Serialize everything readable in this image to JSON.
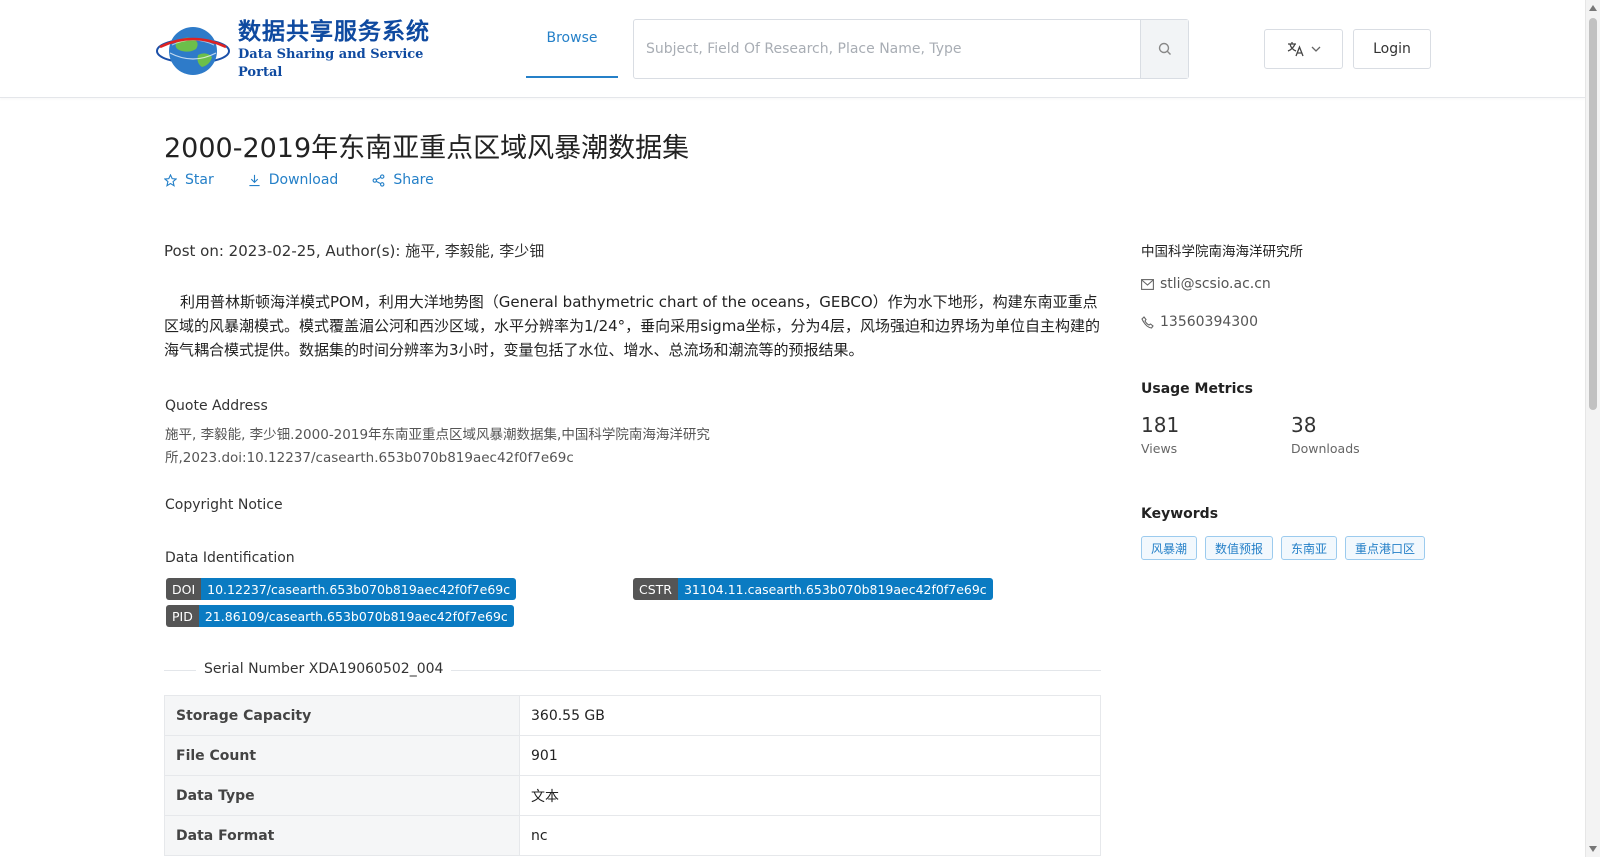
{
  "header": {
    "logo_cn": "数据共享服务系统",
    "logo_en": "Data Sharing and Service Portal",
    "nav_browse": "Browse",
    "search_placeholder": "Subject, Field Of Research, Place Name, Type",
    "login_label": "Login"
  },
  "dataset": {
    "title": "2000-2019年东南亚重点区域风暴潮数据集",
    "actions": {
      "star": "Star",
      "download": "Download",
      "share": "Share"
    },
    "post_on": "Post on: 2023-02-25, Author(s): 施平, 李毅能, 李少钿",
    "abstract": "利用普林斯顿海洋模式POM，利用大洋地势图（General bathymetric chart of the oceans，GEBCO）作为水下地形，构建东南亚重点区域的风暴潮模式。模式覆盖湄公河和西沙区域，水平分辨率为1/24°，垂向采用sigma坐标，分为4层，风场强迫和边界场为单位自主构建的海气耦合模式提供。数据集的时间分辨率为3小时，变量包括了水位、增水、总流场和潮流等的预报结果。",
    "quote_label": "Quote Address",
    "quote_text": "施平, 李毅能, 李少钿.2000-2019年东南亚重点区域风暴潮数据集,中国科学院南海海洋研究所,2023.doi:10.12237/casearth.653b070b819aec42f0f7e69c",
    "copyright_label": "Copyright Notice",
    "data_id_label": "Data Identification",
    "identifiers": {
      "doi_key": "DOI",
      "doi_val": "10.12237/casearth.653b070b819aec42f0f7e69c",
      "cstr_key": "CSTR",
      "cstr_val": "31104.11.casearth.653b070b819aec42f0f7e69c",
      "pid_key": "PID",
      "pid_val": "21.86109/casearth.653b070b819aec42f0f7e69c"
    },
    "serial_number": "Serial Number XDA19060502_004",
    "table": [
      {
        "k": "Storage Capacity",
        "v": "360.55 GB"
      },
      {
        "k": "File Count",
        "v": "901"
      },
      {
        "k": "Data Type",
        "v": "文本"
      },
      {
        "k": "Data Format",
        "v": "nc"
      }
    ]
  },
  "sidebar": {
    "org": "中国科学院南海海洋研究所",
    "email": "stli@scsio.ac.cn",
    "phone": "13560394300",
    "usage_heading": "Usage Metrics",
    "views_num": "181",
    "views_label": "Views",
    "downloads_num": "38",
    "downloads_label": "Downloads",
    "keywords_heading": "Keywords",
    "keywords": [
      "风暴潮",
      "数值预报",
      "东南亚",
      "重点港口区"
    ]
  },
  "colors": {
    "accent": "#2580c8",
    "badge_blue": "#0a7bc2",
    "badge_gray": "#555555"
  },
  "icons": [
    "globe-logo-icon",
    "search-icon",
    "translate-icon",
    "chevron-down-icon",
    "star-icon",
    "download-icon",
    "share-icon",
    "mail-icon",
    "phone-icon"
  ]
}
